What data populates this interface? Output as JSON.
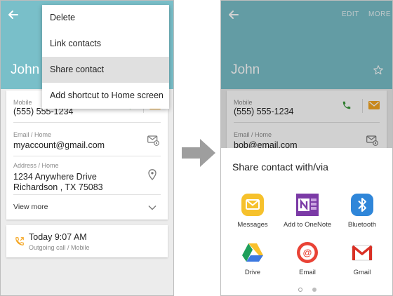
{
  "left": {
    "contact_name": "John",
    "menu": [
      {
        "label": "Delete",
        "highlighted": false
      },
      {
        "label": "Link contacts",
        "highlighted": false
      },
      {
        "label": "Share contact",
        "highlighted": true
      },
      {
        "label": "Add shortcut to Home screen",
        "highlighted": false
      }
    ],
    "mobile_label": "Mobile",
    "mobile_value": "(555) 555-1234",
    "email_label": "Email / Home",
    "email_value": "myaccount@gmail.com",
    "address_label": "Address / Home",
    "address_line1": "1234 Anywhere Drive",
    "address_line2": "Richardson , TX 75083",
    "view_more": "View more",
    "recent_time": "Today 9:07 AM",
    "recent_sub": "Outgoing call / Mobile"
  },
  "right": {
    "edit_label": "EDIT",
    "more_label": "MORE",
    "contact_name": "John",
    "mobile_label": "Mobile",
    "mobile_value": "(555) 555-1234",
    "email_label": "Email / Home",
    "email_value_partial": "bob@email.com",
    "sheet_title": "Share contact with/via",
    "apps": [
      {
        "label": "Messages",
        "icon": "messages-icon"
      },
      {
        "label": "Add to OneNote",
        "icon": "onenote-icon"
      },
      {
        "label": "Bluetooth",
        "icon": "bluetooth-icon"
      },
      {
        "label": "Drive",
        "icon": "drive-icon"
      },
      {
        "label": "Email",
        "icon": "email-app-icon"
      },
      {
        "label": "Gmail",
        "icon": "gmail-icon"
      }
    ],
    "page_count": 2,
    "active_page": 1
  },
  "colors": {
    "header_teal": "#79bfc9",
    "menu_highlight": "#e0e0e0",
    "call_green": "#3d9a3d",
    "message_orange": "#f5a623",
    "transition_arrow": "#9e9e9e"
  }
}
